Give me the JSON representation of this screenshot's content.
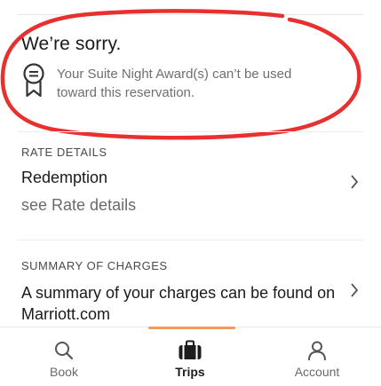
{
  "alert": {
    "title": "We’re sorry.",
    "message": "Your Suite Night Award(s) can’t be used toward this reservation.",
    "icon": "award-ribbon-icon",
    "annotation_color": "#e8312f"
  },
  "rate_details": {
    "label": "RATE DETAILS",
    "title": "Redemption",
    "link": "see Rate details"
  },
  "summary": {
    "label": "SUMMARY OF CHARGES",
    "text": "A summary of your charges can be found on Marriott.com"
  },
  "tabbar": {
    "accent_color": "#f39a5c",
    "tabs": [
      {
        "label": "Book",
        "icon": "search-icon"
      },
      {
        "label": "Trips",
        "icon": "briefcase-icon",
        "active": true
      },
      {
        "label": "Account",
        "icon": "person-icon"
      }
    ]
  }
}
